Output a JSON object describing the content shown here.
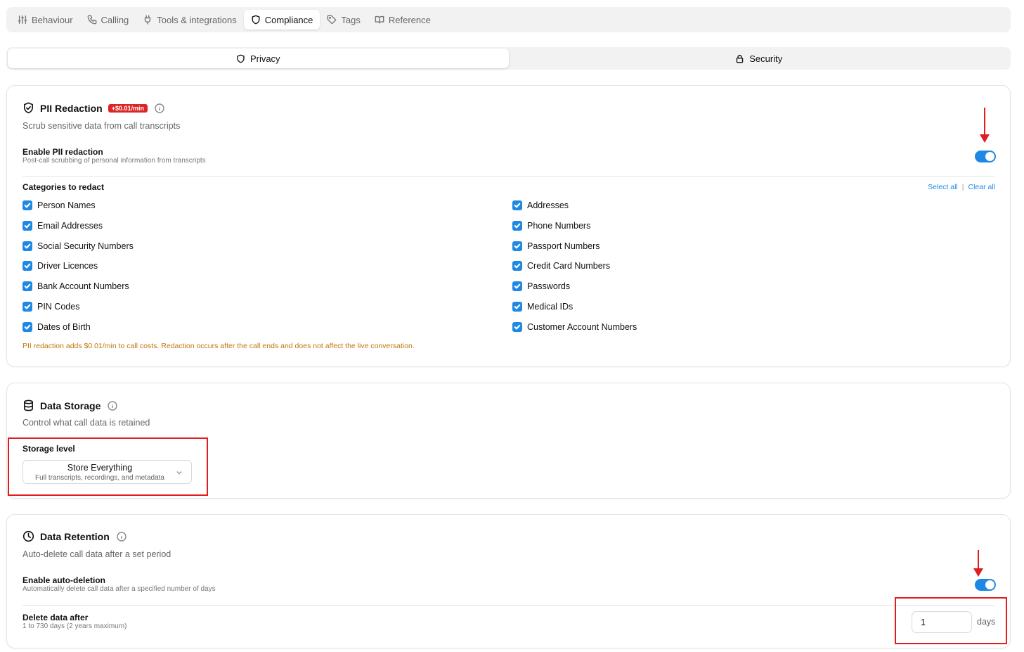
{
  "top_tabs": [
    {
      "label": "Behaviour",
      "icon": "sliders-icon"
    },
    {
      "label": "Calling",
      "icon": "phone-icon"
    },
    {
      "label": "Tools & integrations",
      "icon": "plug-icon"
    },
    {
      "label": "Compliance",
      "icon": "shield-icon",
      "active": true
    },
    {
      "label": "Tags",
      "icon": "tag-icon"
    },
    {
      "label": "Reference",
      "icon": "book-icon"
    }
  ],
  "sub_tabs": [
    {
      "label": "Privacy",
      "icon": "shield-icon",
      "active": true
    },
    {
      "label": "Security",
      "icon": "lock-icon"
    }
  ],
  "pii": {
    "title": "PII Redaction",
    "badge": "+$0.01/min",
    "subtitle": "Scrub sensitive data from call transcripts",
    "enable_label": "Enable PII redaction",
    "enable_hint": "Post-call scrubbing of personal information from transcripts",
    "enabled": true,
    "categories_label": "Categories to redact",
    "select_all": "Select all",
    "separator": "|",
    "clear_all": "Clear all",
    "categories_left": [
      "Person Names",
      "Email Addresses",
      "Social Security Numbers",
      "Driver Licences",
      "Bank Account Numbers",
      "PIN Codes",
      "Dates of Birth"
    ],
    "categories_right": [
      "Addresses",
      "Phone Numbers",
      "Passport Numbers",
      "Credit Card Numbers",
      "Passwords",
      "Medical IDs",
      "Customer Account Numbers"
    ],
    "note": "PII redaction adds $0.01/min to call costs. Redaction occurs after the call ends and does not affect the live conversation."
  },
  "storage": {
    "title": "Data Storage",
    "subtitle": "Control what call data is retained",
    "level_label": "Storage level",
    "selected": "Store Everything",
    "selected_desc": "Full transcripts, recordings, and metadata"
  },
  "retention": {
    "title": "Data Retention",
    "subtitle": "Auto-delete call data after a set period",
    "enable_label": "Enable auto-deletion",
    "enable_hint": "Automatically delete call data after a specified number of days",
    "enabled": true,
    "delete_label": "Delete data after",
    "delete_hint": "1 to 730 days (2 years maximum)",
    "days_value": "1",
    "days_unit": "days"
  },
  "colors": {
    "accent": "#1e88e5",
    "annotation": "#e11d1d",
    "warning_text": "#c2760b",
    "badge": "#dc2626"
  }
}
